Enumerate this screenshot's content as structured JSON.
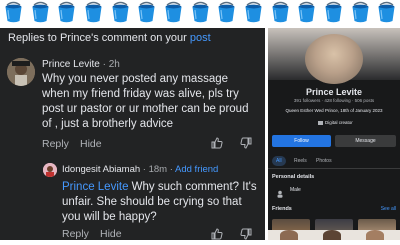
{
  "emoji_row": {
    "count": 15,
    "icon": "bucket-icon",
    "color": "#1e8fe1"
  },
  "replies": {
    "header_prefix": "Replies to Prince's comment on your",
    "header_link": "post"
  },
  "comment1": {
    "author": "Prince Levite",
    "time": " · 2h",
    "text": "Why you never posted any massage when my friend friday was alive, pls try post ur pastor or ur mother can be proud of , just a brotherly advice",
    "reply_label": "Reply",
    "hide_label": "Hide"
  },
  "comment2": {
    "author": "Idongesit Abiamah",
    "time": " · 18m · ",
    "add_friend": "Add friend",
    "mention": "Prince Levite",
    "text": " Why such comment? It's unfair. She should be crying  so that you will be happy?",
    "reply_label": "Reply",
    "hide_label": "Hide"
  },
  "profile": {
    "name": "Prince Levite",
    "stats": "391 followers · 428 following · 506 posts",
    "bio": "Queen Esther Wed Prince, 18th of January 2023",
    "creator": "Digital creator",
    "follow_label": "Follow",
    "message_label": "Message",
    "tabs": [
      "All",
      "Reels",
      "Photos"
    ],
    "personal_details_title": "Personal details",
    "gender": "Male",
    "friends_title": "Friends",
    "see_all": "See all"
  },
  "colors": {
    "panel_bg": "#222324",
    "accent_blue": "#4599ff",
    "follow_blue": "#2374e1"
  }
}
